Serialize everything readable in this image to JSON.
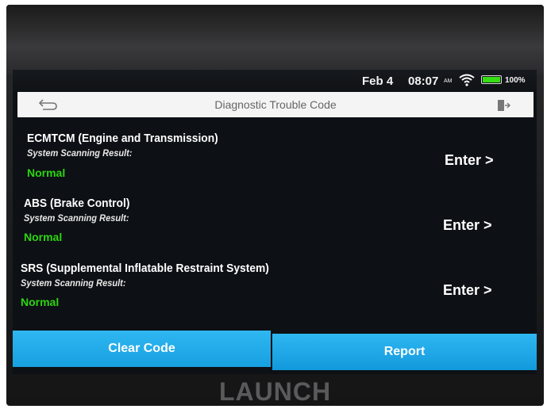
{
  "status_bar": {
    "date": "Feb 4",
    "time": "08:07",
    "meridiem": "AM",
    "battery": "100%"
  },
  "header": {
    "title": "Diagnostic Trouble Code",
    "back_icon": "back-arrow-icon",
    "exit_icon": "exit-icon"
  },
  "systems": [
    {
      "name": "ECMTCM (Engine and Transmission)",
      "label": "System Scanning Result:",
      "status": "Normal",
      "action": "Enter >"
    },
    {
      "name": "ABS (Brake Control)",
      "label": "System Scanning Result:",
      "status": "Normal",
      "action": "Enter >"
    },
    {
      "name": "SRS (Supplemental Inflatable Restraint System)",
      "label": "System Scanning Result:",
      "status": "Normal",
      "action": "Enter >"
    }
  ],
  "footer": {
    "clear_label": "Clear Code",
    "report_label": "Report"
  },
  "device": {
    "brand": "LAUNCH"
  },
  "colors": {
    "status_normal": "#2bd60f",
    "button_blue": "#1da9e8",
    "battery_green": "#34e012"
  }
}
